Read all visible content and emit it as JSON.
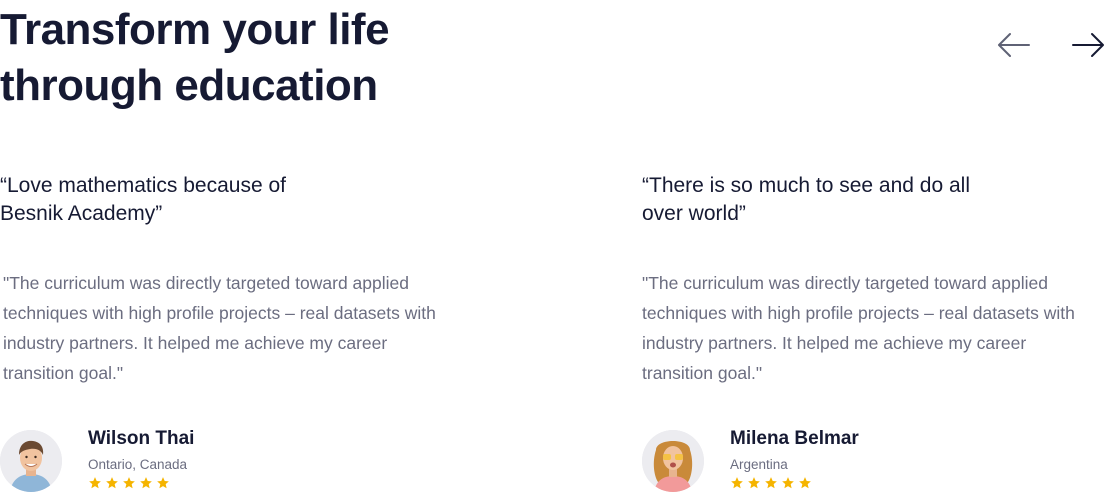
{
  "section": {
    "heading_line1": "Transform your life",
    "heading_line2": "through education"
  },
  "nav": {
    "prev_icon": "arrow-left-icon",
    "next_icon": "arrow-right-icon",
    "arrow_color": "#161a33"
  },
  "testimonials": [
    {
      "title_line1": "“Love mathematics because of",
      "title_line2": "Besnik Academy”",
      "body": "\"The curriculum was directly targeted toward applied techniques with high profile projects – real datasets with industry partners. It helped me achieve my career transition goal.\"",
      "name": "Wilson Thai",
      "location": "Ontario, Canada",
      "rating": 5
    },
    {
      "title_line1": "“There is so much to see and do all",
      "title_line2": "over world”",
      "body": "\"The curriculum was directly targeted toward applied techniques with high profile projects – real datasets with industry partners. It helped me achieve my career transition goal.\"",
      "name": "Milena Belmar",
      "location": "Argentina",
      "rating": 5
    }
  ],
  "colors": {
    "heading": "#161a33",
    "body_text": "#6b6d80",
    "star": "#f5b400"
  }
}
